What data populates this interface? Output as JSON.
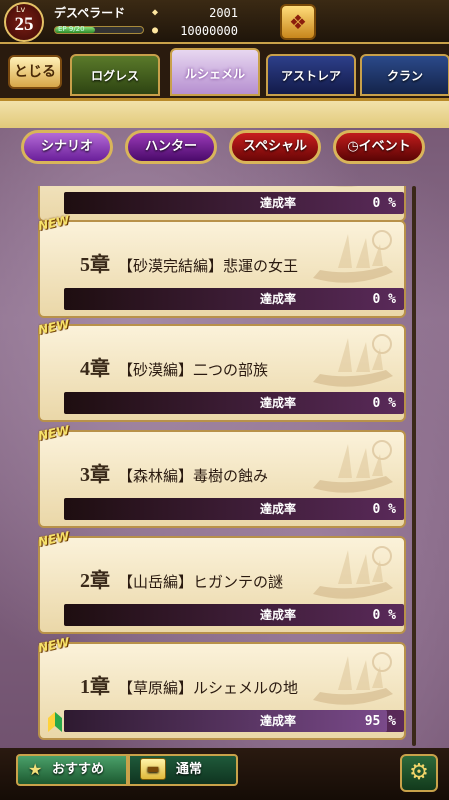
{
  "header": {
    "level_label": "Lv",
    "level": "25",
    "player_name": "デスペラード",
    "ep_text": "EP 9/20",
    "gems": "2001",
    "gold": "10000000",
    "ep_fraction": 0.45
  },
  "nav": {
    "close_label": "とじる",
    "tabs": [
      {
        "label": "ログレス"
      },
      {
        "label": "ルシェメル"
      },
      {
        "label": "アストレア"
      },
      {
        "label": "クラン"
      }
    ],
    "active_tab": "ルシェメル"
  },
  "categories": [
    {
      "label": "シナリオ"
    },
    {
      "label": "ハンター"
    },
    {
      "label": "スペシャル"
    },
    {
      "label": "イベント"
    }
  ],
  "rate_label": "達成率",
  "chapters": [
    {
      "chapter": "",
      "title": "",
      "rate": "0 %",
      "rate_value": 0,
      "new": false
    },
    {
      "chapter": "5章",
      "title": "【砂漠完結編】悲運の女王",
      "rate": "0 %",
      "rate_value": 0,
      "new": true
    },
    {
      "chapter": "4章",
      "title": "【砂漠編】二つの部族",
      "rate": "0 %",
      "rate_value": 0,
      "new": true
    },
    {
      "chapter": "3章",
      "title": "【森林編】毒樹の蝕み",
      "rate": "0 %",
      "rate_value": 0,
      "new": true
    },
    {
      "chapter": "2章",
      "title": "【山岳編】ヒガンテの謎",
      "rate": "0 %",
      "rate_value": 0,
      "new": true
    },
    {
      "chapter": "1章",
      "title": "【草原編】ルシェメルの地",
      "rate": "95 %",
      "rate_value": 95,
      "new": true
    }
  ],
  "new_badge": "NEW",
  "bottom": {
    "recommend_label": "おすすめ",
    "normal_label": "通常"
  },
  "colors": {
    "gold": "#c9a24a",
    "card_bg": "#f5e8c6"
  }
}
